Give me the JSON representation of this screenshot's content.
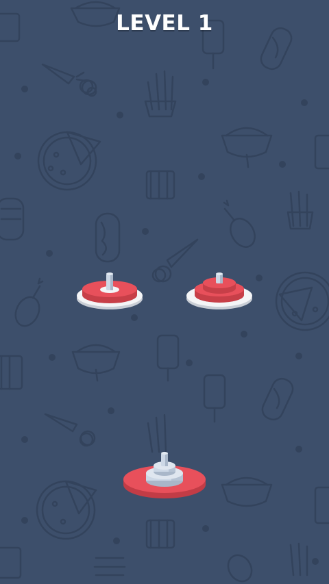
{
  "header": {
    "level_label": "LEVEL 1"
  },
  "colors": {
    "background": "#3d4f6b",
    "doodle_line": "#33435c",
    "ring_red": "#e8505b",
    "ring_red_dark": "#c73f48",
    "base_white": "#f4f5f7",
    "base_shadow": "#c9ced6",
    "peg_blue": "#cdd8e6",
    "peg_blue_dark": "#a9b7c9",
    "base_red": "#e8505b",
    "base_red_dark": "#c23c46"
  },
  "stacks": [
    {
      "name": "stack-left",
      "base": "white",
      "rings": [
        "red-large"
      ]
    },
    {
      "name": "stack-middle",
      "base": "white",
      "rings": [
        "red-large",
        "red-small"
      ]
    },
    {
      "name": "stack-bottom",
      "base": "red",
      "rings": [
        "blue-large",
        "blue-small"
      ]
    }
  ]
}
